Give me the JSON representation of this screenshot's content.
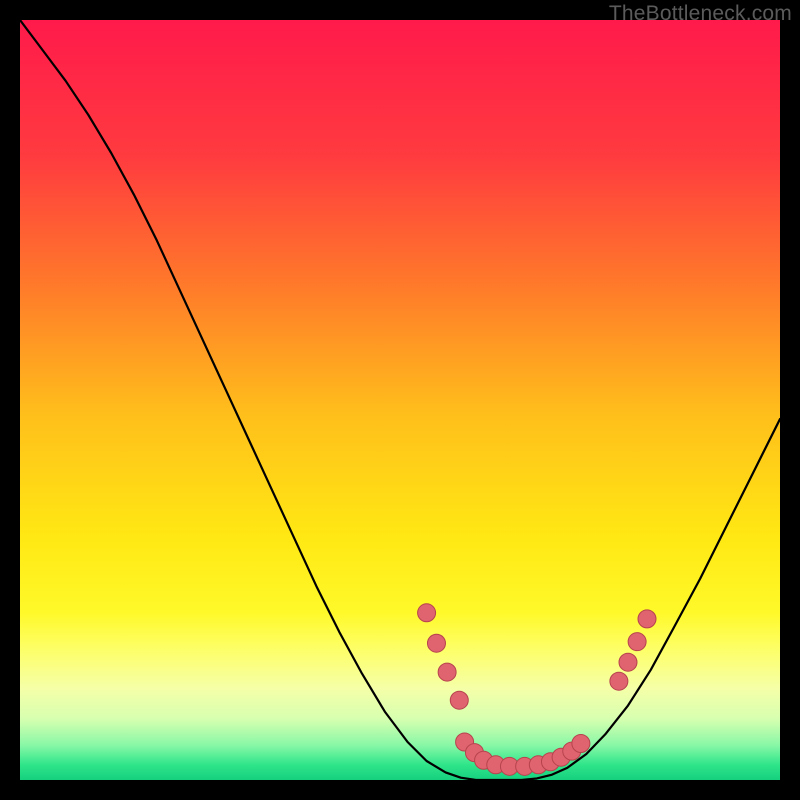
{
  "watermark": "TheBottleneck.com",
  "chart_data": {
    "type": "line",
    "title": "",
    "xlabel": "",
    "ylabel": "",
    "xlim": [
      0,
      100
    ],
    "ylim": [
      0,
      100
    ],
    "background_gradient_stops": [
      {
        "offset": 0.0,
        "color": "#ff1a4b"
      },
      {
        "offset": 0.18,
        "color": "#ff3b3f"
      },
      {
        "offset": 0.35,
        "color": "#ff7a2a"
      },
      {
        "offset": 0.52,
        "color": "#ffbf1b"
      },
      {
        "offset": 0.68,
        "color": "#ffe813"
      },
      {
        "offset": 0.78,
        "color": "#fff92a"
      },
      {
        "offset": 0.83,
        "color": "#fdff6a"
      },
      {
        "offset": 0.88,
        "color": "#f5ffa8"
      },
      {
        "offset": 0.92,
        "color": "#d6ffb0"
      },
      {
        "offset": 0.955,
        "color": "#86f7a6"
      },
      {
        "offset": 0.98,
        "color": "#2fe58a"
      },
      {
        "offset": 1.0,
        "color": "#16d07e"
      }
    ],
    "series": [
      {
        "name": "bottleneck-curve",
        "stroke": "#000000",
        "stroke_width": 2.2,
        "x": [
          0.0,
          3.0,
          6.0,
          9.0,
          12.0,
          15.0,
          18.0,
          21.0,
          24.0,
          27.0,
          30.0,
          33.0,
          36.0,
          39.0,
          42.0,
          45.0,
          48.0,
          51.0,
          53.5,
          56.0,
          58.0,
          60.0,
          62.0,
          64.0,
          66.0,
          68.0,
          70.0,
          72.0,
          74.5,
          77.0,
          80.0,
          83.0,
          86.0,
          89.5,
          93.0,
          96.5,
          100.0
        ],
        "y": [
          100.0,
          96.0,
          92.0,
          87.5,
          82.5,
          77.0,
          71.0,
          64.5,
          58.0,
          51.5,
          45.0,
          38.5,
          32.0,
          25.5,
          19.5,
          14.0,
          9.0,
          5.0,
          2.5,
          1.0,
          0.3,
          0.0,
          0.0,
          0.0,
          0.0,
          0.2,
          0.7,
          1.6,
          3.4,
          6.0,
          9.8,
          14.5,
          20.0,
          26.5,
          33.5,
          40.5,
          47.5
        ]
      }
    ],
    "markers": {
      "name": "curve-dots",
      "fill": "#e0646f",
      "stroke": "#b6434e",
      "r": 9,
      "points": [
        {
          "x": 53.5,
          "y": 22.0
        },
        {
          "x": 54.8,
          "y": 18.0
        },
        {
          "x": 56.2,
          "y": 14.2
        },
        {
          "x": 57.8,
          "y": 10.5
        },
        {
          "x": 58.5,
          "y": 5.0
        },
        {
          "x": 59.8,
          "y": 3.6
        },
        {
          "x": 61.0,
          "y": 2.6
        },
        {
          "x": 62.6,
          "y": 2.0
        },
        {
          "x": 64.4,
          "y": 1.8
        },
        {
          "x": 66.4,
          "y": 1.8
        },
        {
          "x": 68.2,
          "y": 2.0
        },
        {
          "x": 69.8,
          "y": 2.4
        },
        {
          "x": 71.2,
          "y": 3.0
        },
        {
          "x": 72.6,
          "y": 3.8
        },
        {
          "x": 73.8,
          "y": 4.8
        },
        {
          "x": 78.8,
          "y": 13.0
        },
        {
          "x": 80.0,
          "y": 15.5
        },
        {
          "x": 81.2,
          "y": 18.2
        },
        {
          "x": 82.5,
          "y": 21.2
        }
      ]
    }
  }
}
